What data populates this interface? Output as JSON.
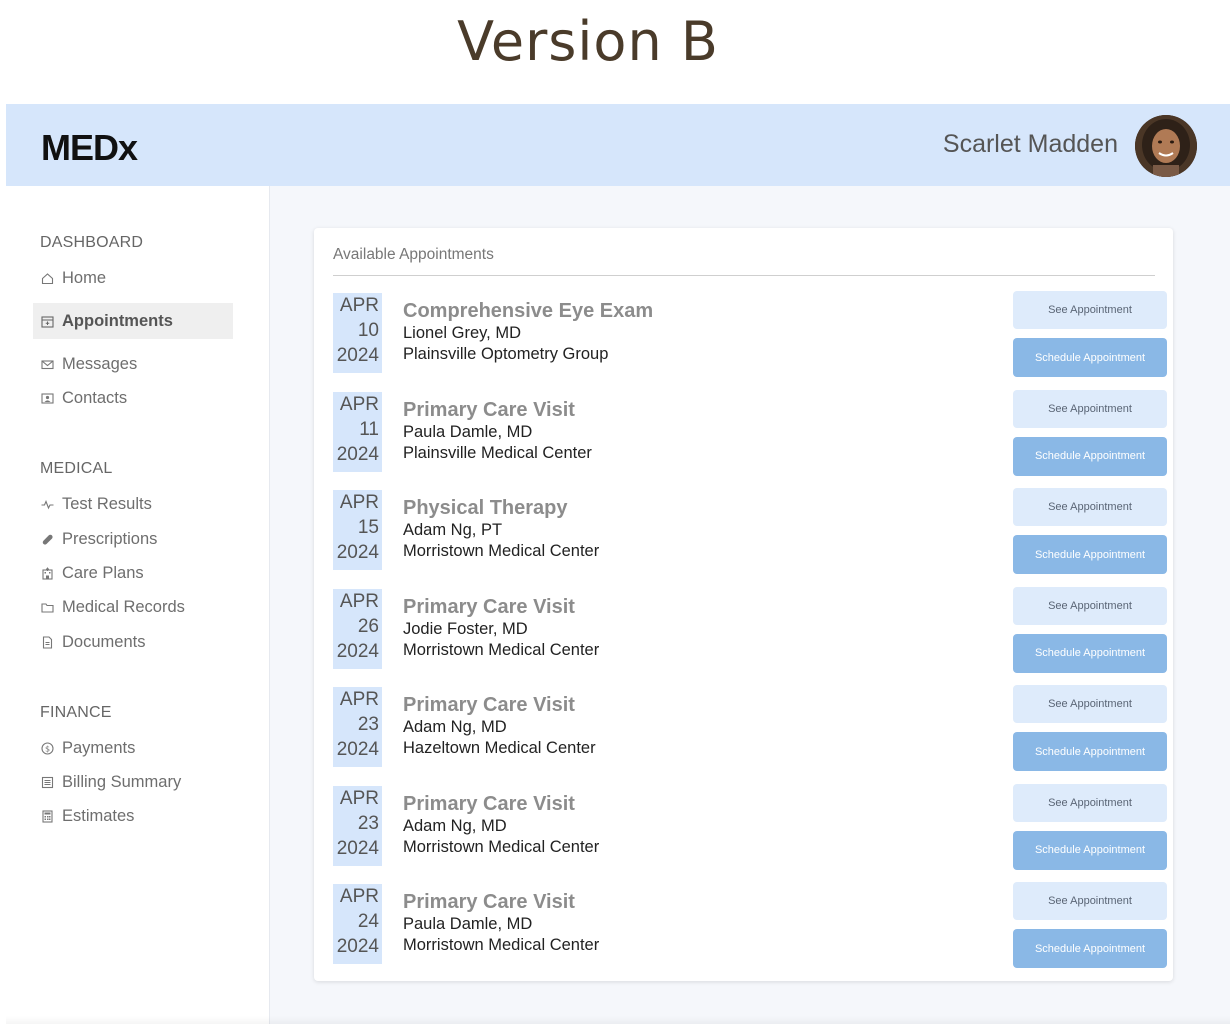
{
  "version_label": "Version B",
  "header": {
    "logo": "MEDx",
    "user_name": "Scarlet Madden"
  },
  "sidebar": {
    "sections": [
      {
        "title": "DASHBOARD",
        "items": [
          {
            "label": "Home",
            "icon": "home-icon"
          },
          {
            "label": "Appointments",
            "icon": "calendar-icon",
            "active": true
          },
          {
            "label": "Messages",
            "icon": "mail-icon"
          },
          {
            "label": "Contacts",
            "icon": "contact-card-icon"
          }
        ]
      },
      {
        "title": "MEDICAL",
        "items": [
          {
            "label": "Test Results",
            "icon": "pulse-icon"
          },
          {
            "label": "Prescriptions",
            "icon": "pill-icon"
          },
          {
            "label": "Care Plans",
            "icon": "hospital-icon"
          },
          {
            "label": "Medical Records",
            "icon": "folder-icon"
          },
          {
            "label": "Documents",
            "icon": "document-icon"
          }
        ]
      },
      {
        "title": "FINANCE",
        "items": [
          {
            "label": "Payments",
            "icon": "dollar-coin-icon"
          },
          {
            "label": "Billing Summary",
            "icon": "receipt-icon"
          },
          {
            "label": "Estimates",
            "icon": "calculator-icon"
          }
        ]
      }
    ]
  },
  "main": {
    "card_title": "Available Appointments",
    "see_label": "See Appointment",
    "schedule_label": "Schedule Appointment",
    "appointments": [
      {
        "month": "APR",
        "day": "10",
        "year": "2024",
        "title": "Comprehensive Eye Exam",
        "doctor": "Lionel Grey, MD",
        "location": "Plainsville Optometry Group"
      },
      {
        "month": "APR",
        "day": "11",
        "year": "2024",
        "title": "Primary Care Visit",
        "doctor": "Paula Damle, MD",
        "location": "Plainsville Medical Center"
      },
      {
        "month": "APR",
        "day": "15",
        "year": "2024",
        "title": "Physical Therapy",
        "doctor": "Adam Ng, PT",
        "location": "Morristown Medical Center"
      },
      {
        "month": "APR",
        "day": "26",
        "year": "2024",
        "title": "Primary Care Visit",
        "doctor": "Jodie Foster, MD",
        "location": "Morristown Medical Center"
      },
      {
        "month": "APR",
        "day": "23",
        "year": "2024",
        "title": "Primary Care Visit",
        "doctor": "Adam Ng, MD",
        "location": "Hazeltown Medical Center"
      },
      {
        "month": "APR",
        "day": "23",
        "year": "2024",
        "title": "Primary Care Visit",
        "doctor": "Adam Ng, MD",
        "location": "Morristown Medical Center"
      },
      {
        "month": "APR",
        "day": "24",
        "year": "2024",
        "title": "Primary Care Visit",
        "doctor": "Paula Damle, MD",
        "location": "Morristown Medical Center"
      }
    ]
  },
  "colors": {
    "header_bg": "#d6e6fb",
    "date_bg": "#d6e6fb",
    "see_btn": "#deebfb",
    "schedule_btn": "#8ab8e6",
    "title_text": "#4a3b2a"
  }
}
